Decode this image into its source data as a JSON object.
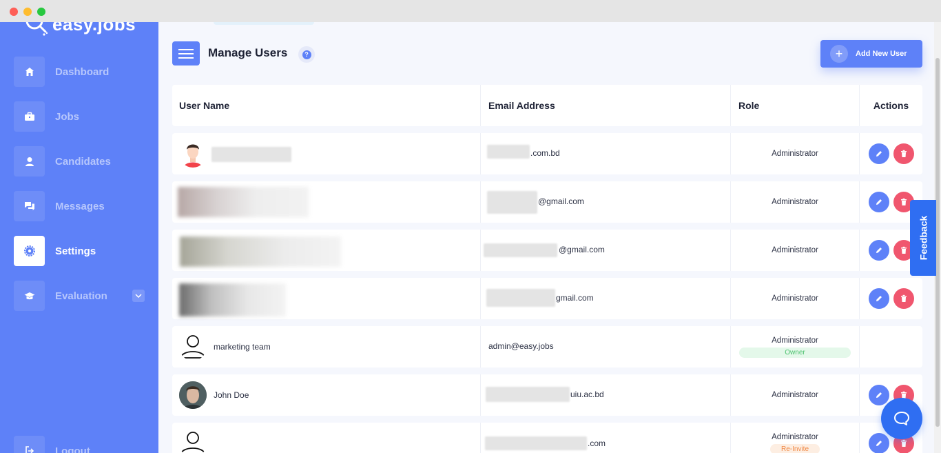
{
  "window": {
    "controls": [
      "close",
      "minimize",
      "maximize"
    ]
  },
  "brand": {
    "name": "easy.jobs",
    "logo_icon": "magnifier-logo-icon"
  },
  "sidebar": {
    "items": [
      {
        "label": "Dashboard",
        "icon": "home-icon",
        "active": false
      },
      {
        "label": "Jobs",
        "icon": "briefcase-icon",
        "active": false
      },
      {
        "label": "Candidates",
        "icon": "person-icon",
        "active": false
      },
      {
        "label": "Messages",
        "icon": "chat-bubbles-icon",
        "active": false
      },
      {
        "label": "Settings",
        "icon": "gear-icon",
        "active": true
      },
      {
        "label": "Evaluation",
        "icon": "graduation-cap-icon",
        "active": false,
        "expandable": true
      }
    ],
    "logout_label": "Logout"
  },
  "header": {
    "title": "Manage Users",
    "help_icon": "?",
    "add_button_label": "Add New User"
  },
  "table": {
    "columns": [
      "User Name",
      "Email Address",
      "Role",
      "Actions"
    ],
    "rows": [
      {
        "name": "",
        "email_suffix": ".com.bd",
        "role": "Administrator",
        "badge": "",
        "avatar": "male-avatar-icon",
        "actions": true
      },
      {
        "name": "",
        "email_suffix": "@gmail.com",
        "role": "Administrator",
        "badge": "",
        "avatar": "photo",
        "actions": true
      },
      {
        "name": "",
        "email_suffix": "@gmail.com",
        "role": "Administrator",
        "badge": "",
        "avatar": "photo",
        "actions": true
      },
      {
        "name": "",
        "email_suffix": "gmail.com",
        "role": "Administrator",
        "badge": "",
        "avatar": "photo",
        "actions": true
      },
      {
        "name": "marketing team",
        "email": "admin@easy.jobs",
        "role": "Administrator",
        "badge": "Owner",
        "avatar": "user-outline-icon",
        "actions": false
      },
      {
        "name": "John Doe",
        "email_suffix": "uiu.ac.bd",
        "role": "Administrator",
        "badge": "",
        "avatar": "photo",
        "actions": true
      },
      {
        "name": "",
        "email_suffix": ".com",
        "role": "Administrator",
        "badge": "Re-Invite",
        "avatar": "user-outline-icon",
        "actions": true
      }
    ]
  },
  "feedback_label": "Feedback",
  "colors": {
    "sidebar": "#5e81f8",
    "primary": "#5e81f8",
    "danger": "#f0566e",
    "owner_badge": "#4cc26e",
    "reinvite_badge": "#f08a48",
    "feedback": "#2f6ef2"
  }
}
